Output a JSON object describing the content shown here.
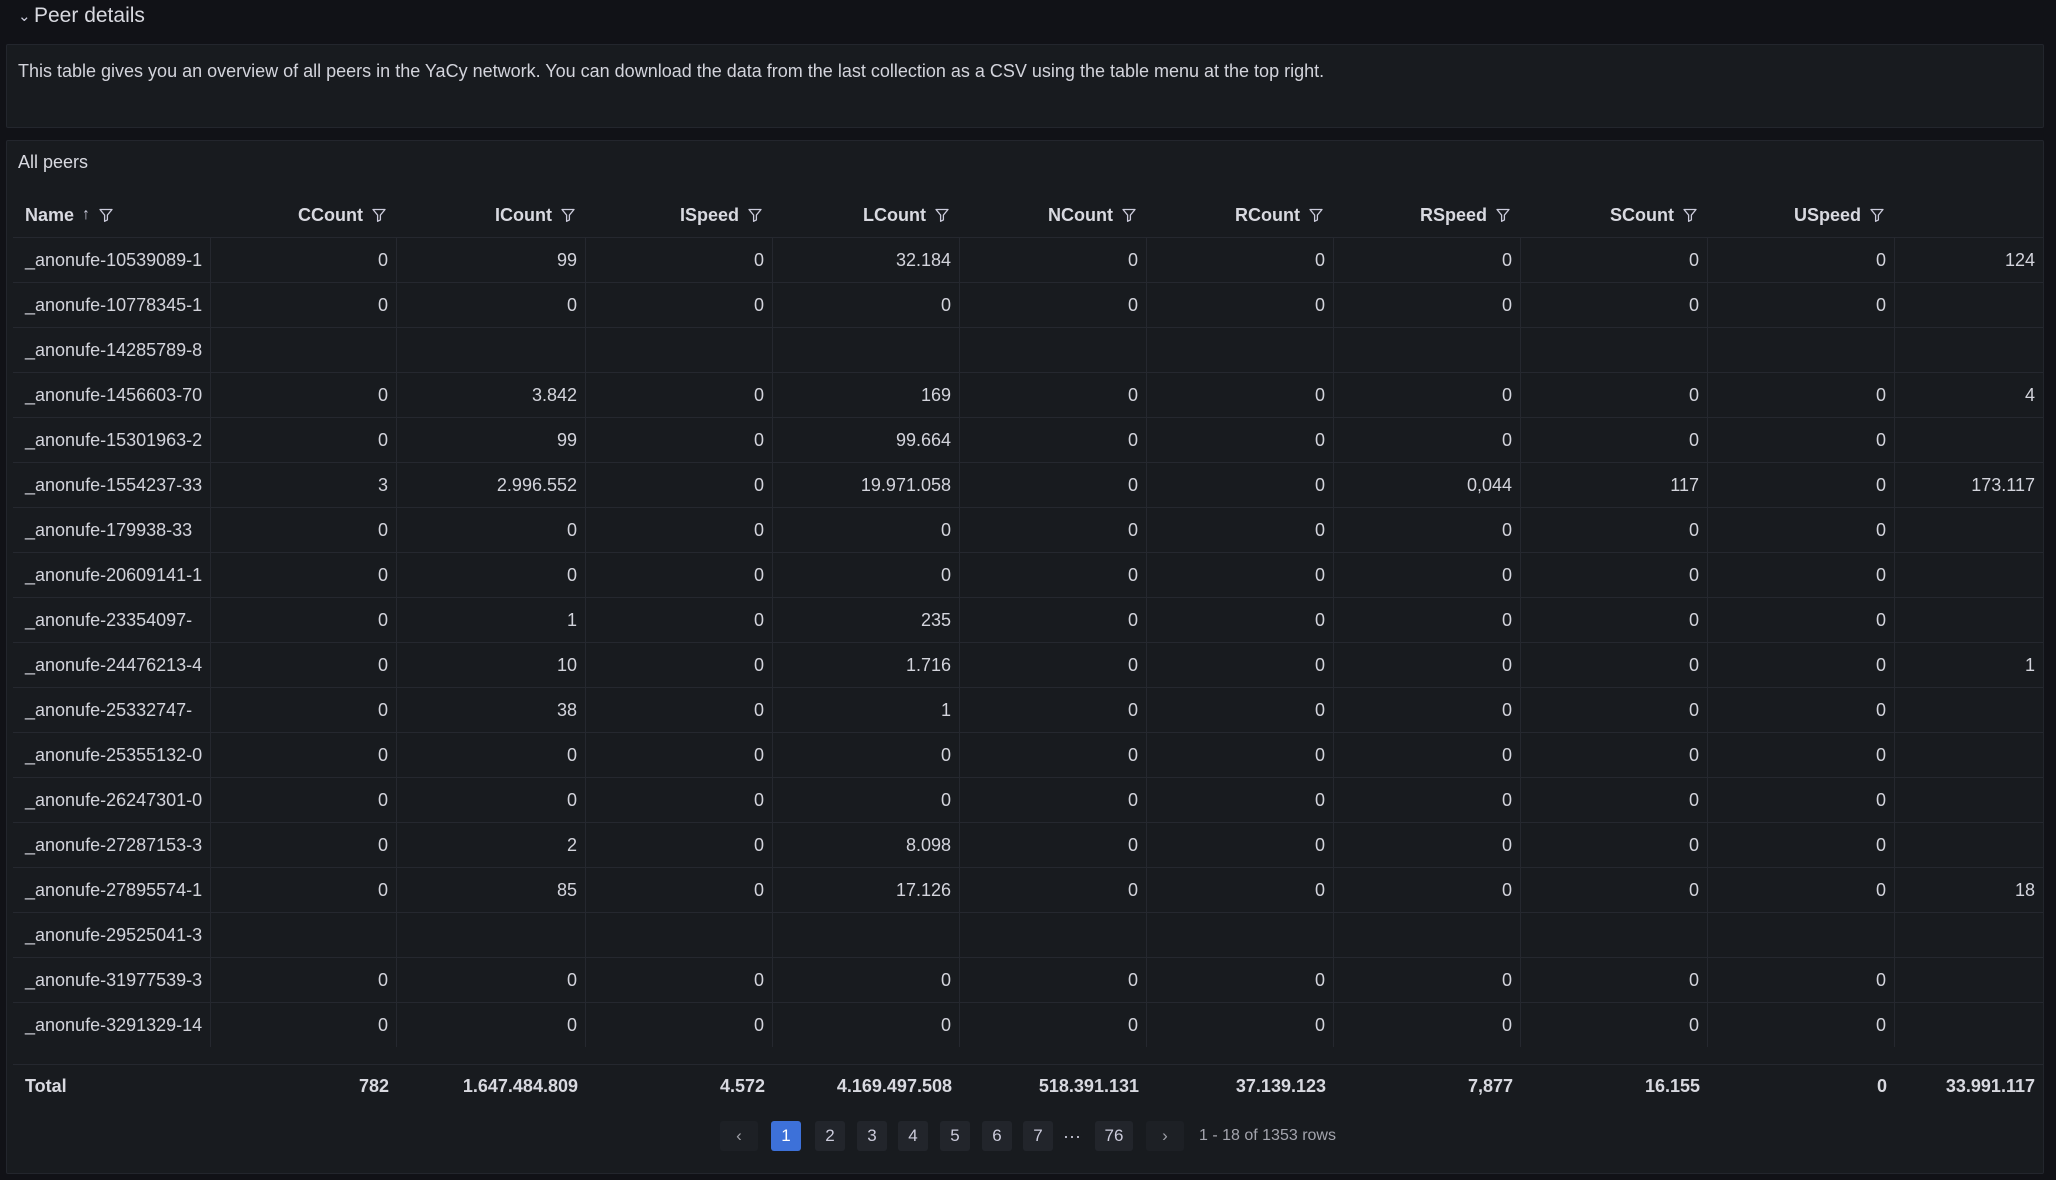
{
  "row_header": {
    "chevron": "⌄",
    "title": "Peer details"
  },
  "text_panel": {
    "text": "This table gives you an overview of all peers in the YaCy network. You can download the data from the last collection as a CSV using the table menu at the top right."
  },
  "table_panel": {
    "title": "All peers",
    "columns": [
      "Name",
      "CCount",
      "ICount",
      "ISpeed",
      "LCount",
      "NCount",
      "RCount",
      "RSpeed",
      "SCount",
      "USpeed"
    ],
    "sort_icon": "↑",
    "rows": [
      [
        "_anonufe-10539089-1",
        "0",
        "99",
        "0",
        "32.184",
        "0",
        "0",
        "0",
        "0",
        "0",
        "124"
      ],
      [
        "_anonufe-10778345-1",
        "0",
        "0",
        "0",
        "0",
        "0",
        "0",
        "0",
        "0",
        "0",
        ""
      ],
      [
        "_anonufe-14285789-8",
        "",
        "",
        "",
        "",
        "",
        "",
        "",
        "",
        "",
        ""
      ],
      [
        "_anonufe-1456603-70",
        "0",
        "3.842",
        "0",
        "169",
        "0",
        "0",
        "0",
        "0",
        "0",
        "4"
      ],
      [
        "_anonufe-15301963-2",
        "0",
        "99",
        "0",
        "99.664",
        "0",
        "0",
        "0",
        "0",
        "0",
        ""
      ],
      [
        "_anonufe-1554237-33",
        "3",
        "2.996.552",
        "0",
        "19.971.058",
        "0",
        "0",
        "0,044",
        "117",
        "0",
        "173.117"
      ],
      [
        "_anonufe-179938-33",
        "0",
        "0",
        "0",
        "0",
        "0",
        "0",
        "0",
        "0",
        "0",
        ""
      ],
      [
        "_anonufe-20609141-1",
        "0",
        "0",
        "0",
        "0",
        "0",
        "0",
        "0",
        "0",
        "0",
        ""
      ],
      [
        "_anonufe-23354097-",
        "0",
        "1",
        "0",
        "235",
        "0",
        "0",
        "0",
        "0",
        "0",
        ""
      ],
      [
        "_anonufe-24476213-4",
        "0",
        "10",
        "0",
        "1.716",
        "0",
        "0",
        "0",
        "0",
        "0",
        "1"
      ],
      [
        "_anonufe-25332747-",
        "0",
        "38",
        "0",
        "1",
        "0",
        "0",
        "0",
        "0",
        "0",
        ""
      ],
      [
        "_anonufe-25355132-0",
        "0",
        "0",
        "0",
        "0",
        "0",
        "0",
        "0",
        "0",
        "0",
        ""
      ],
      [
        "_anonufe-26247301-0",
        "0",
        "0",
        "0",
        "0",
        "0",
        "0",
        "0",
        "0",
        "0",
        ""
      ],
      [
        "_anonufe-27287153-3",
        "0",
        "2",
        "0",
        "8.098",
        "0",
        "0",
        "0",
        "0",
        "0",
        ""
      ],
      [
        "_anonufe-27895574-1",
        "0",
        "85",
        "0",
        "17.126",
        "0",
        "0",
        "0",
        "0",
        "0",
        "18"
      ],
      [
        "_anonufe-29525041-3",
        "",
        "",
        "",
        "",
        "",
        "",
        "",
        "",
        "",
        ""
      ],
      [
        "_anonufe-31977539-3",
        "0",
        "0",
        "0",
        "0",
        "0",
        "0",
        "0",
        "0",
        "0",
        ""
      ],
      [
        "_anonufe-3291329-14",
        "0",
        "0",
        "0",
        "0",
        "0",
        "0",
        "0",
        "0",
        "0",
        ""
      ]
    ],
    "footer": [
      "Total",
      "782",
      "1.647.484.809",
      "4.572",
      "4.169.497.508",
      "518.391.131",
      "37.139.123",
      "7,877",
      "16.155",
      "0",
      "33.991.117"
    ]
  },
  "pagination": {
    "prev": "‹",
    "next": "›",
    "pages": [
      "1",
      "2",
      "3",
      "4",
      "5",
      "6",
      "7"
    ],
    "ellipsis": "···",
    "last_page": "76",
    "active_page": "1",
    "info": "1 - 18 of 1353 rows"
  },
  "icons": {
    "filter": "filter-icon",
    "sort": "sort-ascending-icon",
    "chevron": "chevron-down-icon"
  },
  "colors": {
    "background": "#111217",
    "panel": "#181b1f",
    "active_page": "#3d71d9",
    "text": "#ccccdc"
  }
}
